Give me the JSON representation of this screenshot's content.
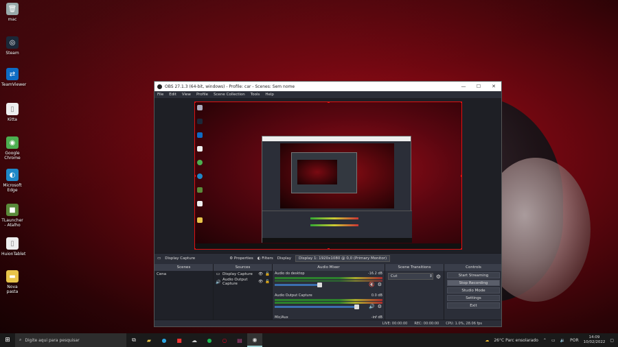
{
  "desktop": {
    "icons": [
      {
        "label": "mac",
        "icon": "recycle-bin-icon",
        "color": "#9aa"
      },
      {
        "label": "Steam",
        "icon": "steam-icon",
        "color": "#1b2838"
      },
      {
        "label": "TeamViewer",
        "icon": "teamviewer-icon",
        "color": "#0e6cc4"
      },
      {
        "label": "Kitta",
        "icon": "file-icon",
        "color": "#eeeeee"
      },
      {
        "label": "Google Chrome",
        "icon": "chrome-icon",
        "color": "#4caf50"
      },
      {
        "label": "Microsoft Edge",
        "icon": "edge-icon",
        "color": "#1e88c8"
      },
      {
        "label": "TLauncher - Atalho",
        "icon": "minecraft-icon",
        "color": "#5a8a3a"
      },
      {
        "label": "HuionTablet",
        "icon": "file-icon",
        "color": "#eeeeee"
      },
      {
        "label": "Nova pasta",
        "icon": "folder-icon",
        "color": "#e8c44a"
      }
    ]
  },
  "obs": {
    "title": "OBS 27.1.3 (64-bit, windows) - Profile: car - Scenes: Sem nome",
    "menu": [
      "File",
      "Edit",
      "View",
      "Profile",
      "Scene Collection",
      "Tools",
      "Help"
    ],
    "source_bar": {
      "source_name": "Display Capture",
      "properties": "Properties",
      "filters": "Filters",
      "display_label": "Display",
      "display_value": "Display 1: 1920x1080 @ 0,0 (Primary Monitor)"
    },
    "docks": {
      "scenes": {
        "header": "Scenes",
        "items": [
          "Cena"
        ]
      },
      "sources": {
        "header": "Sources",
        "items": [
          {
            "name": "Display Capture",
            "icon": "monitor-icon"
          },
          {
            "name": "Audio Output Capture",
            "icon": "speaker-icon"
          }
        ]
      },
      "mixer": {
        "header": "Audio Mixer",
        "tracks": [
          {
            "name": "Audio do desktop",
            "db": "-16.2 dB",
            "level": 0.89,
            "muted": true
          },
          {
            "name": "Audio Output Capture",
            "db": "0.0 dB",
            "level": 1.0,
            "muted": false
          },
          {
            "name": "Mic/Aux",
            "db": "-inf dB",
            "level": 0,
            "muted": false
          }
        ]
      },
      "transitions": {
        "header": "Scene Transitions",
        "selected": "Cut"
      },
      "controls": {
        "header": "Controls",
        "buttons": [
          "Start Streaming",
          "Stop Recording",
          "Studio Mode",
          "Settings",
          "Exit"
        ]
      }
    },
    "status": {
      "live": "LIVE: 00:00:00",
      "rec": "REC: 00:00:00",
      "cpu": "CPU: 1.0%, 28.06 fps"
    }
  },
  "taskbar": {
    "search_placeholder": "Digite aqui para pesquisar",
    "weather": "26°C  Parc ensolarado",
    "lang": "POR",
    "time": "14:09",
    "date": "10/02/2022"
  },
  "colors": {
    "accent": "#e01010",
    "obs_bg": "#2b2e38"
  }
}
